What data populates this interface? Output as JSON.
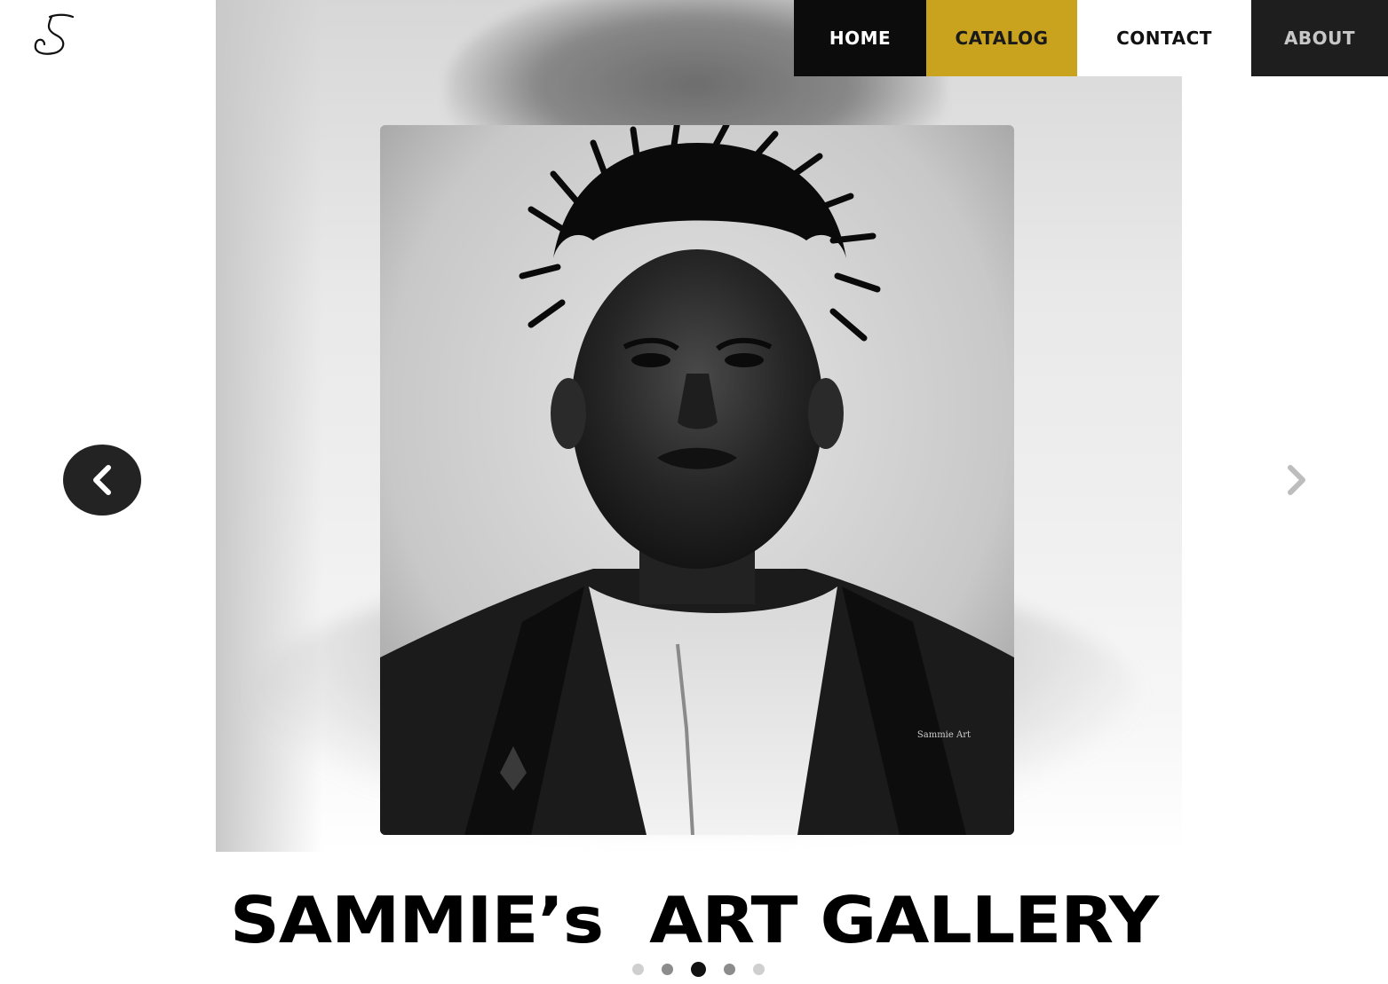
{
  "brand": {
    "logo_icon": "script-s-logo-icon"
  },
  "nav": {
    "items": [
      {
        "label": "HOME"
      },
      {
        "label": "CATALOG"
      },
      {
        "label": "CONTACT"
      },
      {
        "label": "ABOUT"
      }
    ]
  },
  "carousel": {
    "prev_icon": "chevron-left-icon",
    "next_icon": "chevron-right-icon",
    "artwork_signature": "Sammie Art",
    "dots": {
      "count": 5,
      "active_index": 2
    }
  },
  "hero": {
    "title": "SAMMIE’s  ART GALLERY"
  },
  "colors": {
    "accent": "#c9a21e",
    "nav_dark": "#0c0c0c",
    "about_bg": "#1e1e1e",
    "arrow_bg": "#232323"
  }
}
